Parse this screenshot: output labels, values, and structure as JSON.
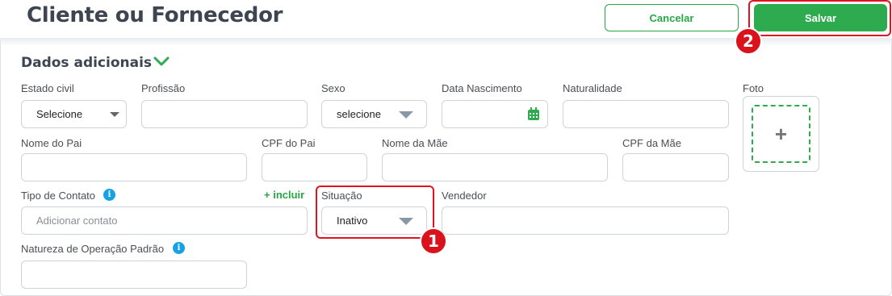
{
  "header": {
    "title": "Cliente ou Fornecedor",
    "cancel_label": "Cancelar",
    "save_label": "Salvar"
  },
  "badges": {
    "one": "1",
    "two": "2"
  },
  "section": {
    "title": "Dados adicionais"
  },
  "fields": {
    "estado_civil": {
      "label": "Estado civil",
      "value": "Selecione"
    },
    "profissao": {
      "label": "Profissão",
      "value": ""
    },
    "sexo": {
      "label": "Sexo",
      "value": "selecione"
    },
    "data_nascimento": {
      "label": "Data Nascimento",
      "value": ""
    },
    "naturalidade": {
      "label": "Naturalidade",
      "value": ""
    },
    "foto": {
      "label": "Foto",
      "add_glyph": "+"
    },
    "nome_pai": {
      "label": "Nome do Pai",
      "value": ""
    },
    "cpf_pai": {
      "label": "CPF do Pai",
      "value": ""
    },
    "nome_mae": {
      "label": "Nome da Mãe",
      "value": ""
    },
    "cpf_mae": {
      "label": "CPF da Mãe",
      "value": ""
    },
    "tipo_contato": {
      "label": "Tipo de Contato",
      "placeholder": "Adicionar contato",
      "add_label": "+ incluir"
    },
    "situacao": {
      "label": "Situação",
      "value": "Inativo"
    },
    "vendedor": {
      "label": "Vendedor",
      "value": ""
    },
    "natureza_operacao": {
      "label": "Natureza de Operação Padrão",
      "value": ""
    }
  },
  "icons": {
    "info": "info-icon",
    "calendar": "calendar-icon",
    "chevron": "chevron-down-icon",
    "plus": "plus-icon"
  },
  "colors": {
    "accent_green": "#2eab4f",
    "highlight_red": "#e0141e",
    "info_blue": "#17a2e6"
  }
}
